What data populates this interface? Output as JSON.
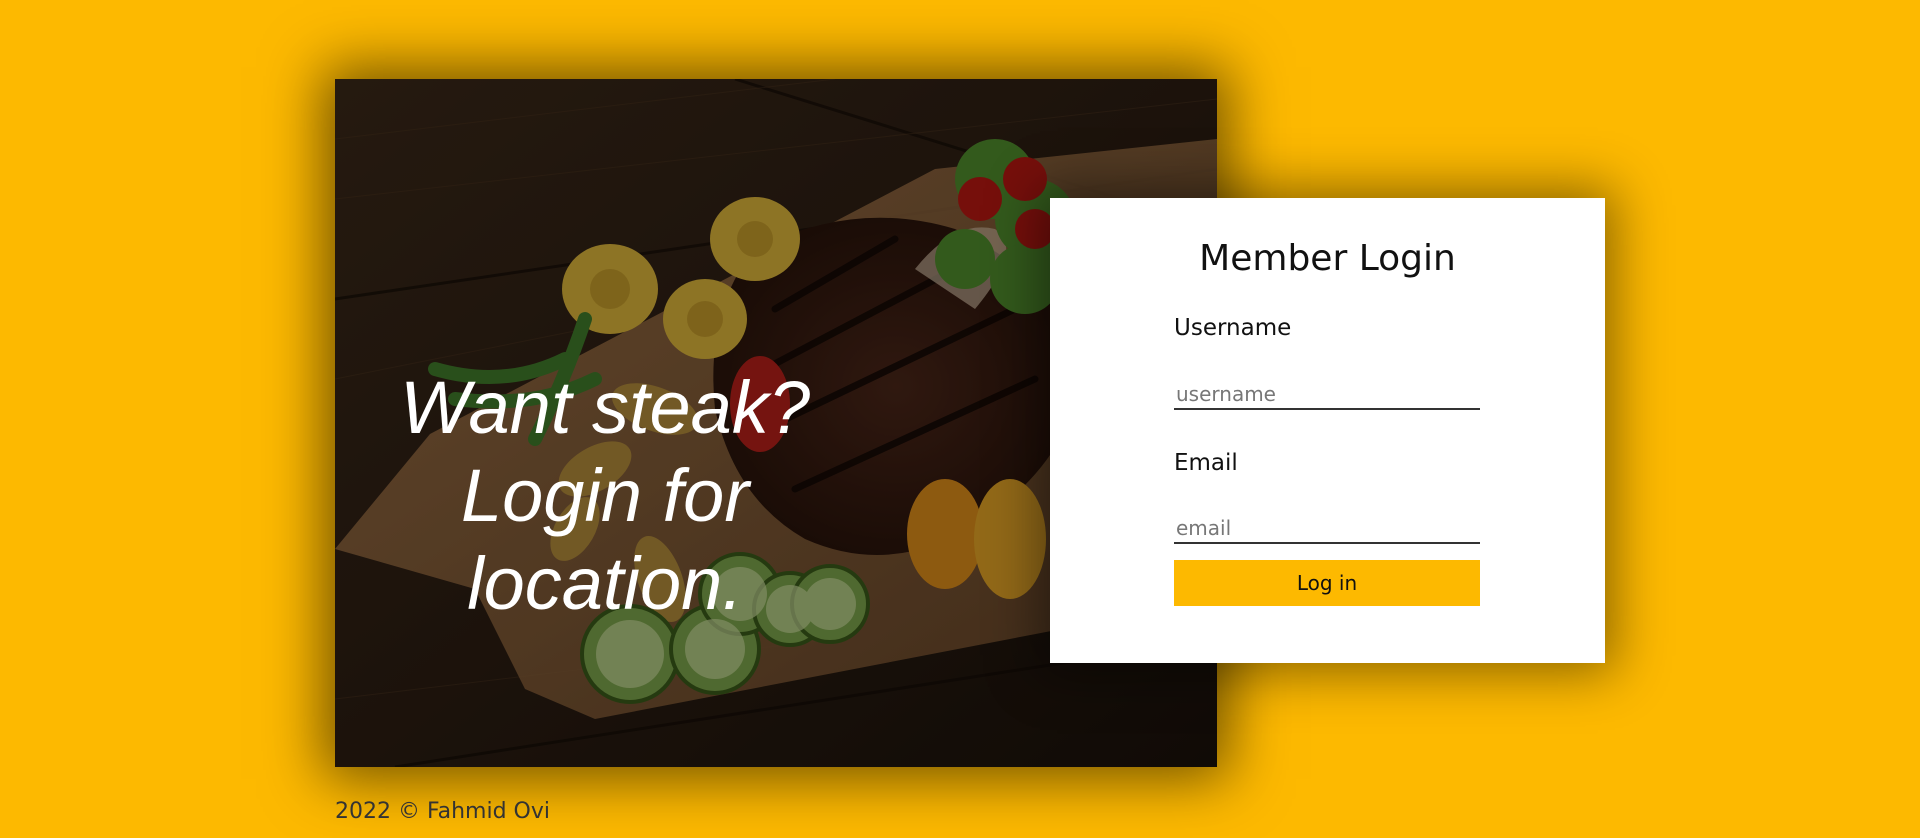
{
  "hero": {
    "line1": "Want steak?",
    "line2": "Login for",
    "line3": "location."
  },
  "login": {
    "title": "Member Login",
    "username_label": "Username",
    "username_placeholder": "username",
    "username_value": "",
    "email_label": "Email",
    "email_placeholder": "email",
    "email_value": "",
    "submit_label": "Log in"
  },
  "footer": {
    "text": "2022 © Fahmid Ovi"
  },
  "colors": {
    "background": "#FDB900",
    "accent": "#FDB900",
    "card": "#FFFFFF"
  }
}
